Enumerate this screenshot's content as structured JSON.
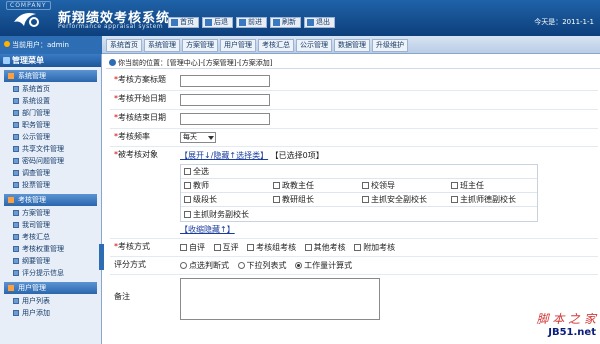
{
  "header": {
    "company": "COMPANY",
    "title": "新翔绩效考核系统",
    "subtitle": "Performance appraisal system",
    "today": "今天是：2011-1-1",
    "top_buttons": [
      {
        "label": "首页",
        "icon": "home-icon"
      },
      {
        "label": "后退",
        "icon": "back-icon"
      },
      {
        "label": "前进",
        "icon": "forward-icon"
      },
      {
        "label": "刷新",
        "icon": "refresh-icon"
      },
      {
        "label": "退出",
        "icon": "exit-icon"
      }
    ]
  },
  "subbar": {
    "current_user": "当前用户：admin",
    "tabs": [
      "系统首页",
      "系统管理",
      "方案管理",
      "用户管理",
      "考核汇总",
      "公示管理",
      "数据管理",
      "升级维护"
    ]
  },
  "sidebar": {
    "title": "管理菜单",
    "groups": [
      {
        "title": "系统管理",
        "items": [
          "系统首页",
          "系统设置",
          "部门管理",
          "职务管理",
          "公示管理",
          "共享文件管理",
          "密码问题管理",
          "调查管理",
          "投票管理"
        ]
      },
      {
        "title": "考核管理",
        "items": [
          "方案管理",
          "我司管理",
          "考核汇总",
          "考核权重管理",
          "纲要管理",
          "评分提示信息"
        ]
      },
      {
        "title": "用户管理",
        "items": [
          "用户列表",
          "用户添加"
        ]
      }
    ]
  },
  "content": {
    "breadcrumb": "你当前的位置：[管理中心]-[方案管理]-[方案添加]",
    "form": {
      "scheme_title_label": "考核方案标题",
      "start_date_label": "考核开始日期",
      "end_date_label": "考核结束日期",
      "frequency_label": "考核频率",
      "frequency_value": "每天",
      "targets_label": "被考核对象",
      "targets_expand": "【展开↓/隐藏↑选择类】",
      "targets_selected": "【已选择0项】",
      "targets_options": [
        [
          "全选"
        ],
        [
          "教师",
          "政教主任",
          "校领导",
          "班主任"
        ],
        [
          "级段长",
          "教研组长",
          "主抓安全副校长",
          "主抓师德副校长"
        ],
        [
          "主抓财务副校长"
        ]
      ],
      "collapse_link": "【收缩隐藏↑】",
      "method_label": "考核方式",
      "method_options": [
        "自评",
        "互评",
        "考核组考核",
        "其他考核",
        "附加考核"
      ],
      "score_label": "评分方式",
      "score_options": [
        "点选判断式",
        "下拉列表式",
        "工作量计算式"
      ],
      "score_selected": 2,
      "note_label": "备注"
    }
  },
  "watermark": {
    "line1": "脚 本 之 家",
    "line2": "JB51.net"
  }
}
